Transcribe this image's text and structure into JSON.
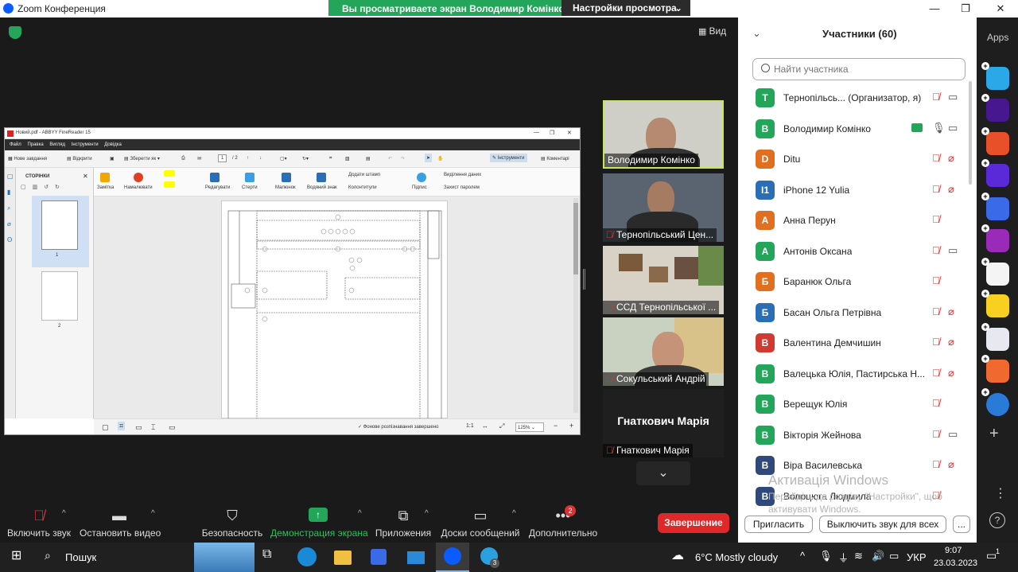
{
  "window": {
    "title": "Zoom Конференция",
    "banner_text": "Вы просматриваете экран Володимир Комінко",
    "view_settings": "Настройки просмотра",
    "view_button": "Вид"
  },
  "abbyy": {
    "title": "Новий.pdf - ABBYY FineReader 15",
    "menu": [
      "Файл",
      "Правка",
      "Вигляд",
      "Інструменти",
      "Довідка"
    ],
    "toolbar": {
      "new_task": "Нове завдання",
      "open": "Відкрити",
      "save_as": "Зберегти як",
      "page": "1",
      "pages_total": "/ 2",
      "tools": "Інструменти",
      "comments": "Коментарі"
    },
    "pages_panel_title": "СТОРІНКИ",
    "page_labels": [
      "1",
      "2"
    ],
    "ribbon": [
      "Замітка",
      "Намалювати",
      "Редагувати",
      "Стерти",
      "Малюнок",
      "Водяний знак",
      "Додати штамп",
      "Колонтитули",
      "Підпис",
      "Виділення даних",
      "Захист паролем"
    ],
    "status_text": "Фонове розпізнавання завершено",
    "zoom_ratio": "1:1",
    "zoom": "125%"
  },
  "videos": [
    {
      "name": "Володимир Комінко",
      "muted": false
    },
    {
      "name": "Тернопільський Цен...",
      "muted": true
    },
    {
      "name": "ССД Тернопільської ...",
      "muted": true
    },
    {
      "name": "Сокульський Андрій",
      "muted": true
    },
    {
      "name": "Гнаткович Марія",
      "muted": true,
      "big_name": "Гнаткович Марія"
    }
  ],
  "participants": {
    "title": "Участники (60)",
    "search_placeholder": "Найти участника",
    "list": [
      {
        "initial": "T",
        "name": "Тернопільсь...  (Организатор, я)",
        "color": "#23a55a",
        "mic": "muted",
        "cam": "on"
      },
      {
        "initial": "В",
        "name": "Володимир Комінко",
        "color": "#23a55a",
        "mic": "on",
        "cam": "on",
        "sharing": true
      },
      {
        "initial": "D",
        "name": "Ditu",
        "color": "#e07020",
        "mic": "muted",
        "cam": "off"
      },
      {
        "initial": "I1",
        "name": "iPhone 12 Yulia",
        "color": "#2a6fb5",
        "mic": "muted",
        "cam": "off"
      },
      {
        "initial": "А",
        "name": "Анна Перун",
        "color": "#e07020",
        "mic": "muted",
        "cam": "none"
      },
      {
        "initial": "А",
        "name": "Антонів Оксана",
        "color": "#23a55a",
        "mic": "muted",
        "cam": "on"
      },
      {
        "initial": "Б",
        "name": "Баранюк Ольга",
        "color": "#e07020",
        "mic": "muted",
        "cam": "none"
      },
      {
        "initial": "Б",
        "name": "Басан Ольга Петрівна",
        "color": "#2a6fb5",
        "mic": "muted",
        "cam": "off"
      },
      {
        "initial": "В",
        "name": "Валентина Демчишин",
        "color": "#d03a30",
        "mic": "muted",
        "cam": "off"
      },
      {
        "initial": "В",
        "name": "Валецька Юлія, Пастирська Н...",
        "color": "#23a55a",
        "mic": "muted",
        "cam": "off"
      },
      {
        "initial": "В",
        "name": "Верещук Юлія",
        "color": "#23a55a",
        "mic": "muted",
        "cam": "none"
      },
      {
        "initial": "В",
        "name": "Вікторія Жейнова",
        "color": "#23a55a",
        "mic": "muted",
        "cam": "on"
      },
      {
        "initial": "В",
        "name": "Віра Василевська",
        "color": "#2f4a7a",
        "mic": "muted",
        "cam": "off"
      },
      {
        "initial": "В",
        "name": "Волоцюга Людмила",
        "color": "#2f4a7a",
        "mic": "muted",
        "cam": "none"
      }
    ],
    "invite": "Пригласить",
    "mute_all": "Выключить звук для всех",
    "more": "..."
  },
  "watermark": {
    "line1": "Активація Windows",
    "line2": "Перейдіть до розділу \"Настройки\", щоб активувати Windows."
  },
  "apps": {
    "label": "Apps"
  },
  "toolbar": {
    "mute": "Включить звук",
    "video": "Остановить видео",
    "security": "Безопасность",
    "share": "Демонстрация экрана",
    "apps": "Приложения",
    "whiteboards": "Доски сообщений",
    "more": "Дополнительно",
    "more_badge": "2",
    "end": "Завершение"
  },
  "taskbar": {
    "search": "Пошук",
    "weather": "6°C  Mostly cloudy",
    "lang": "УКР",
    "time": "9:07",
    "date": "23.03.2023",
    "telegram_badge": "3",
    "notif_badge": "1"
  },
  "colors": {
    "accent_green": "#23a55a",
    "end_red": "#e02828",
    "zoom_blue": "#0b5cff",
    "muted_red": "#e03030"
  }
}
